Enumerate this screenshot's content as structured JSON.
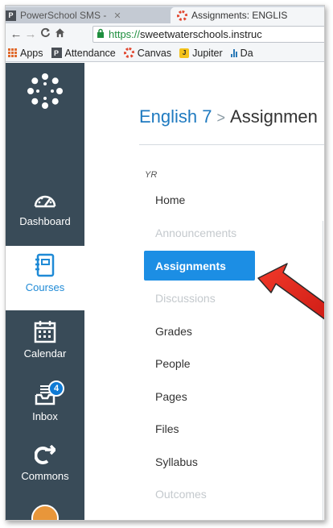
{
  "browser": {
    "tabs": [
      {
        "label": "PowerSchool SMS - ",
        "icon": "powerschool-icon"
      },
      {
        "label": "Assignments: ENGLIS",
        "icon": "canvas-icon"
      }
    ],
    "url_scheme": "https://",
    "url_rest": "sweetwaterschools.instruc",
    "bookmarks": [
      {
        "label": "Apps",
        "icon": "apps-grid-icon"
      },
      {
        "label": "Attendance",
        "icon": "powerschool-icon"
      },
      {
        "label": "Canvas",
        "icon": "canvas-icon"
      },
      {
        "label": "Jupiter",
        "icon": "jupiter-icon"
      },
      {
        "label": "Da",
        "icon": "bar-chart-icon"
      }
    ]
  },
  "global_nav": {
    "items": [
      {
        "label": "Dashboard",
        "icon": "dashboard-gauge-icon"
      },
      {
        "label": "Courses",
        "icon": "courses-notebook-icon",
        "active": true
      },
      {
        "label": "Calendar",
        "icon": "calendar-icon"
      },
      {
        "label": "Inbox",
        "icon": "inbox-tray-icon",
        "badge": "4"
      },
      {
        "label": "Commons",
        "icon": "commons-arrow-icon"
      }
    ]
  },
  "breadcrumb": {
    "course": "English 7",
    "separator": ">",
    "page": "Assignmen"
  },
  "course_nav": {
    "term": "YR",
    "items": [
      {
        "label": "Home",
        "state": "enabled"
      },
      {
        "label": "Announcements",
        "state": "disabled"
      },
      {
        "label": "Assignments",
        "state": "active"
      },
      {
        "label": "Discussions",
        "state": "disabled"
      },
      {
        "label": "Grades",
        "state": "enabled"
      },
      {
        "label": "People",
        "state": "enabled"
      },
      {
        "label": "Pages",
        "state": "enabled"
      },
      {
        "label": "Files",
        "state": "enabled"
      },
      {
        "label": "Syllabus",
        "state": "enabled"
      },
      {
        "label": "Outcomes",
        "state": "disabled"
      }
    ]
  },
  "colors": {
    "nav_bg": "#394b58",
    "active_link": "#1c8ee4",
    "annotation_arrow": "#e8231b"
  }
}
